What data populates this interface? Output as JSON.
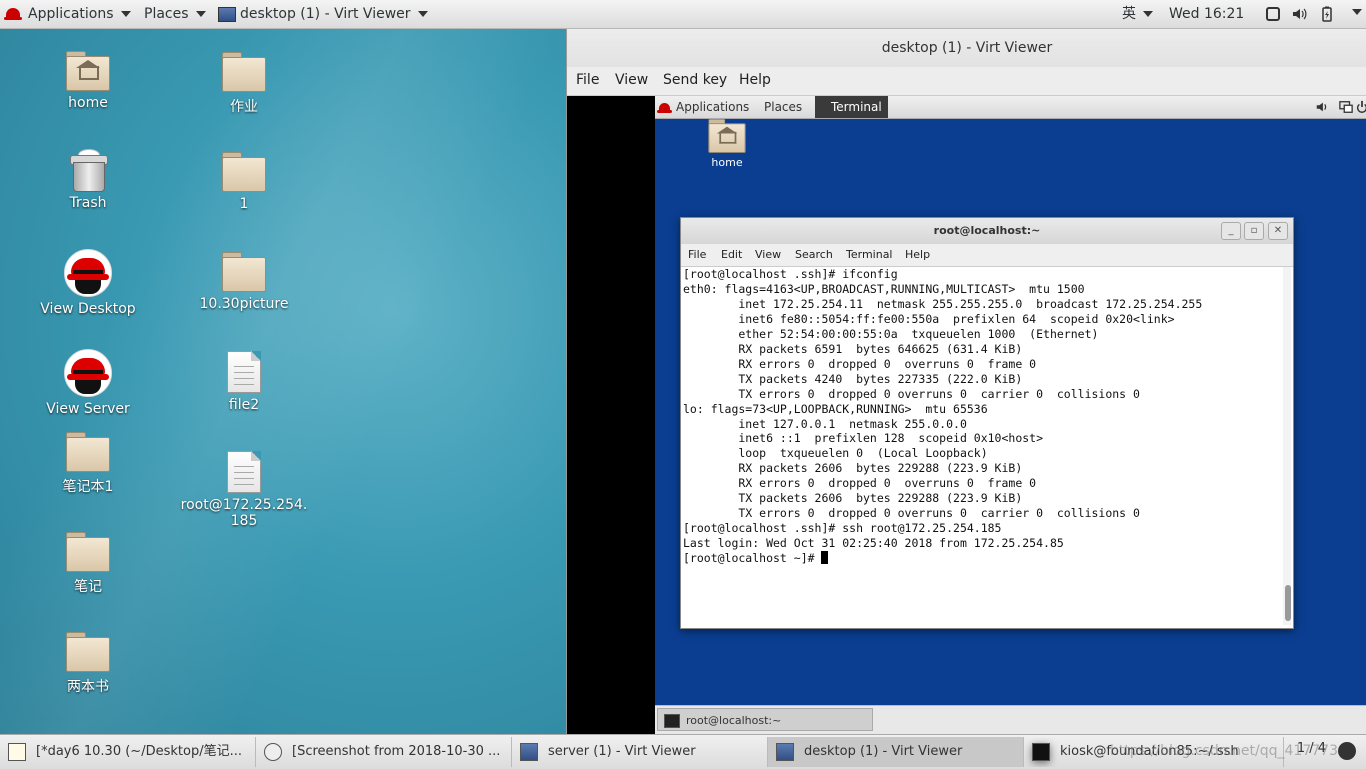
{
  "topbar": {
    "applications": "Applications",
    "places": "Places",
    "active_window": "desktop (1) - Virt Viewer",
    "input_method": "英",
    "clock": "Wed 16:21"
  },
  "desktop": {
    "icons": {
      "home": "home",
      "trash": "Trash",
      "view_desktop": "View Desktop",
      "view_server": "View Server",
      "notebook1": "笔记本1",
      "notes": "笔记",
      "two_books": "两本书",
      "homework": "作业",
      "folder1": "1",
      "picture": "10.30picture",
      "file2": "file2",
      "root_file_line1": "root@172.25.254.",
      "root_file_line2": "185"
    }
  },
  "viewer": {
    "title": "desktop (1) - Virt Viewer",
    "menu": {
      "file": "File",
      "view": "View",
      "send_key": "Send key",
      "help": "Help"
    },
    "guest": {
      "applications": "Applications",
      "places": "Places",
      "terminal": "Terminal",
      "home": "home",
      "task": "root@localhost:~",
      "term": {
        "title": "root@localhost:~",
        "menu": {
          "file": "File",
          "edit": "Edit",
          "view": "View",
          "search": "Search",
          "terminal": "Terminal",
          "help": "Help"
        },
        "lines": [
          "[root@localhost .ssh]# ifconfig",
          "eth0: flags=4163<UP,BROADCAST,RUNNING,MULTICAST>  mtu 1500",
          "        inet 172.25.254.11  netmask 255.255.255.0  broadcast 172.25.254.255",
          "        inet6 fe80::5054:ff:fe00:550a  prefixlen 64  scopeid 0x20<link>",
          "        ether 52:54:00:00:55:0a  txqueuelen 1000  (Ethernet)",
          "        RX packets 6591  bytes 646625 (631.4 KiB)",
          "        RX errors 0  dropped 0  overruns 0  frame 0",
          "        TX packets 4240  bytes 227335 (222.0 KiB)",
          "        TX errors 0  dropped 0 overruns 0  carrier 0  collisions 0",
          "",
          "lo: flags=73<UP,LOOPBACK,RUNNING>  mtu 65536",
          "        inet 127.0.0.1  netmask 255.0.0.0",
          "        inet6 ::1  prefixlen 128  scopeid 0x10<host>",
          "        loop  txqueuelen 0  (Local Loopback)",
          "        RX packets 2606  bytes 229288 (223.9 KiB)",
          "        RX errors 0  dropped 0  overruns 0  frame 0",
          "        TX packets 2606  bytes 229288 (223.9 KiB)",
          "        TX errors 0  dropped 0 overruns 0  carrier 0  collisions 0",
          "",
          "[root@localhost .ssh]# ssh root@172.25.254.185",
          "Last login: Wed Oct 31 02:25:40 2018 from 172.25.254.85",
          "[root@localhost ~]# "
        ]
      }
    }
  },
  "taskbar": {
    "items": [
      "[*day6 10.30 (~/Desktop/笔记...",
      "[Screenshot from 2018-10-30 ...",
      "server (1) - Virt Viewer",
      "desktop (1) - Virt Viewer",
      "kiosk@foundation85:~/.ssh"
    ],
    "pager": "1 / 4",
    "watermark": "https://blog.csdn.net/qq_41777308"
  }
}
